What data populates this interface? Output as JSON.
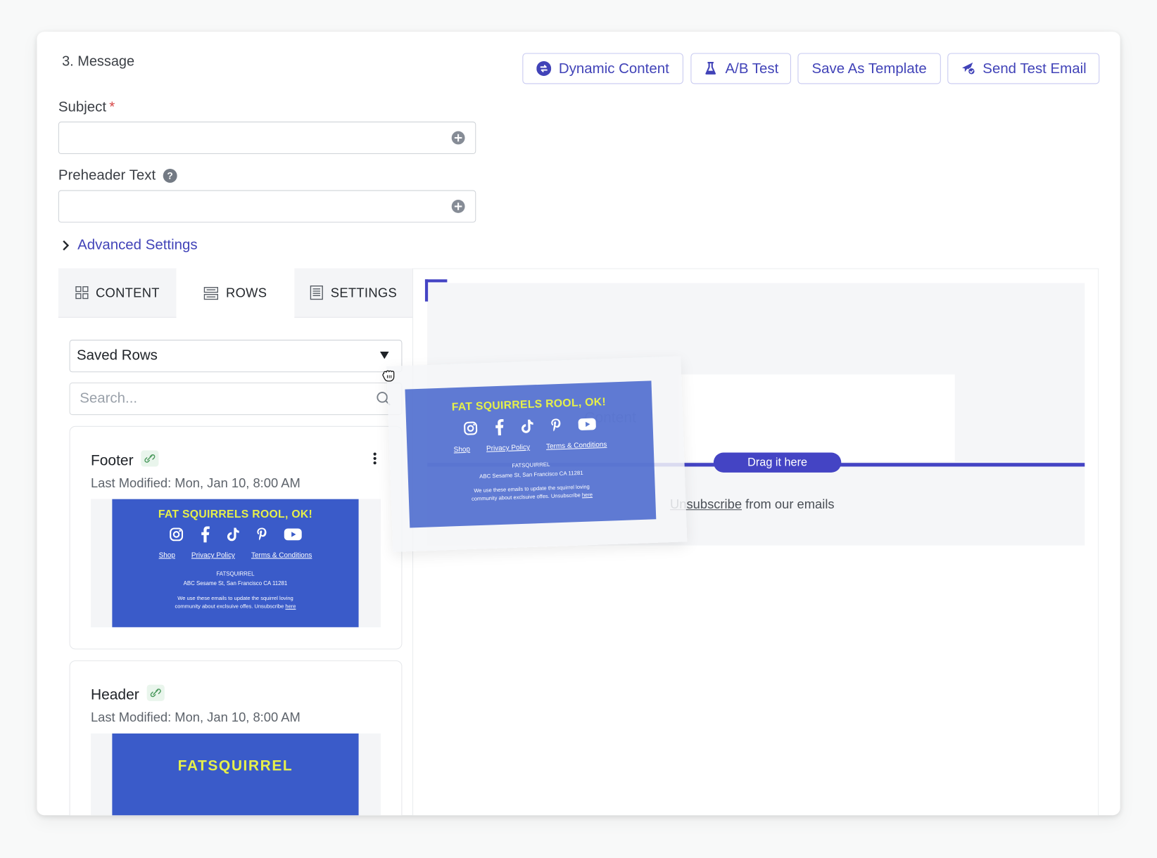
{
  "section": {
    "title": "3. Message"
  },
  "toolbar": {
    "dynamic_content": "Dynamic Content",
    "ab_test": "A/B Test",
    "save_template": "Save As Template",
    "send_test": "Send Test Email"
  },
  "form": {
    "subject_label": "Subject",
    "required_mark": "*",
    "subject_value": "",
    "preheader_label": "Preheader Text",
    "help_glyph": "?",
    "preheader_value": "",
    "advanced_settings": "Advanced Settings"
  },
  "tabs": [
    {
      "label": "CONTENT",
      "icon": "grid-icon",
      "active": false
    },
    {
      "label": "ROWS",
      "icon": "rows-icon",
      "active": true
    },
    {
      "label": "SETTINGS",
      "icon": "document-icon",
      "active": false
    }
  ],
  "rows_panel": {
    "select_value": "Saved Rows",
    "search_placeholder": "Search...",
    "items": [
      {
        "title": "Footer",
        "last_modified": "Last Modified: Mon, Jan 10, 8:00 AM",
        "preview": {
          "headline": "FAT SQUIRRELS ROOL, OK!",
          "links": [
            "Shop",
            "Privacy Policy",
            "Terms & Conditions"
          ],
          "brand": "FATSQUIRREL",
          "address": "ABC Sesame St, San Francisco CA 11281",
          "note_line1": "We use these emails to update the squirrel loving",
          "note_line2": "community about exclsuive offes. Unsubscribe",
          "note_link": "here"
        }
      },
      {
        "title": "Header",
        "last_modified": "Last Modified: Mon, Jan 10, 8:00 AM",
        "preview": {
          "headline": "FATSQUIRREL"
        }
      }
    ]
  },
  "canvas": {
    "content_placeholder": "Content",
    "drop_label": "Drag it here",
    "unsubscribe_link": "Unsubscribe",
    "unsubscribe_rest": " from our emails",
    "dragged": {
      "headline": "FAT SQUIRRELS ROOL, OK!",
      "links": [
        "Shop",
        "Privacy Policy",
        "Terms & Conditions"
      ],
      "brand": "FATSQUIRREL",
      "address": "ABC Sesame St, San Francisco CA 11281",
      "note_line1": "We use these emails to update the squirrel loving",
      "note_line2": "community about exclsuive offes. Unsubscribe",
      "note_link": "here"
    }
  },
  "colors": {
    "accent": "#4143b8",
    "brand_blue": "#3a5bc9",
    "brand_yellow": "#e6f04a",
    "drop_indicator": "#4444c4",
    "required": "#d64545"
  }
}
